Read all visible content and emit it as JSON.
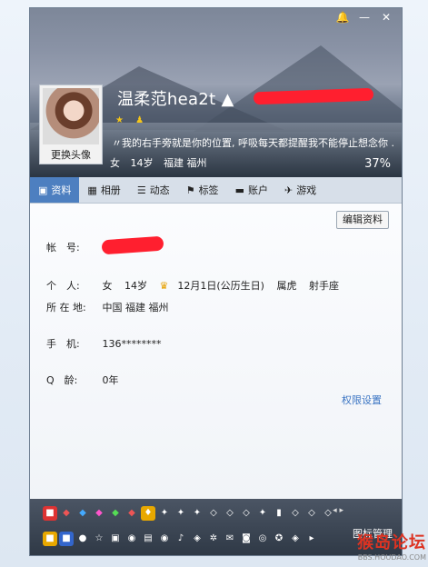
{
  "window": {
    "close_glyph": "✕",
    "min_glyph": "—",
    "skin_glyph": "🔔"
  },
  "profile": {
    "nickname": "温柔范hea2t ▲",
    "avatar_button": "更换头像",
    "badges": [
      "★",
      "♟"
    ],
    "signature": "〃我的右手旁就是你的位置, 呼吸每天都提醒我不能停止想念你 .",
    "gender": "女",
    "age": "14岁",
    "location": "福建 福州",
    "completion": "37%"
  },
  "tabs": [
    {
      "label": "资料",
      "icon": "card-icon"
    },
    {
      "label": "相册",
      "icon": "photo-icon"
    },
    {
      "label": "动态",
      "icon": "list-icon"
    },
    {
      "label": "标签",
      "icon": "bookmark-icon"
    },
    {
      "label": "账户",
      "icon": "wallet-icon"
    },
    {
      "label": "游戏",
      "icon": "game-icon"
    }
  ],
  "content": {
    "edit_button": "编辑资料",
    "account_label": "帐　号:",
    "personal_label": "个　人:",
    "personal_gender": "女",
    "personal_age": "14岁",
    "personal_birthday": "12月1日(公历生日)",
    "personal_zodiac": "属虎",
    "personal_sign": "射手座",
    "location_label": "所 在 地:",
    "location_value": "中国 福建 福州",
    "phone_label": "手　机:",
    "phone_value": "136********",
    "qage_label": "Q　龄:",
    "qage_value": "0年",
    "permission_link": "权限设置"
  },
  "iconbar": {
    "manage_label": "图标管理",
    "arrows": "◂ ▸"
  },
  "watermark": {
    "main": "猴岛论坛",
    "sub": "BBS.HOUDAO.COM"
  },
  "colors": {
    "tab_active": "#4d7fc0",
    "link": "#3a74c3",
    "redaction": "#ff1f2f"
  }
}
